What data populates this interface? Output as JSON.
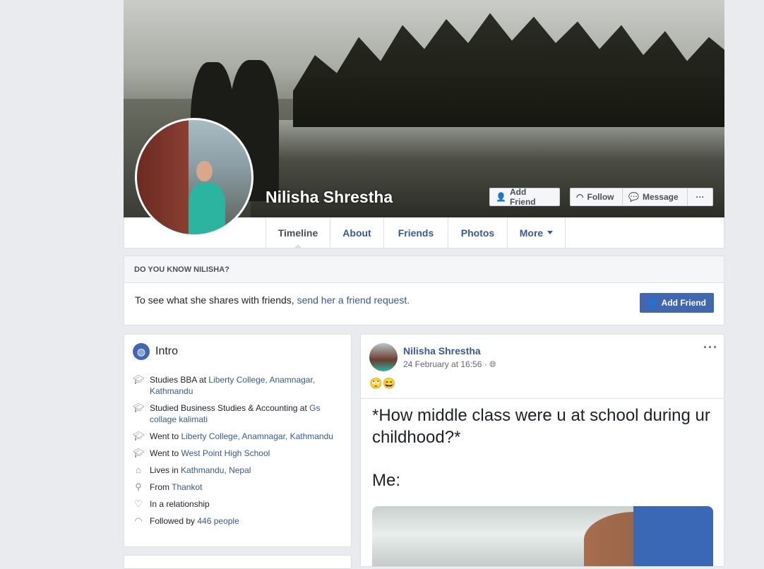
{
  "profile": {
    "name": "Nilisha Shrestha",
    "actions": {
      "add_friend": "Add Friend",
      "follow": "Follow",
      "message": "Message",
      "more": "···"
    }
  },
  "tabs": [
    {
      "label": "Timeline",
      "active": true
    },
    {
      "label": "About"
    },
    {
      "label": "Friends"
    },
    {
      "label": "Photos"
    },
    {
      "label": "More"
    }
  ],
  "know": {
    "heading": "DO YOU KNOW NILISHA?",
    "text": "To see what she shares with friends, ",
    "link": "send her a friend request.",
    "button": "Add Friend"
  },
  "intro": {
    "title": "Intro",
    "items": [
      {
        "icon": "graduation-cap-icon",
        "text": "Studies BBA at ",
        "link": "Liberty College, Anamnagar, Kathmandu"
      },
      {
        "icon": "graduation-cap-icon",
        "text": "Studied Business Studies & Accounting at ",
        "link": "Gs collage kalimati"
      },
      {
        "icon": "graduation-cap-icon",
        "text": "Went to ",
        "link": "Liberty College, Anamnagar, Kathmandu"
      },
      {
        "icon": "graduation-cap-icon",
        "text": "Went to ",
        "link": "West Point High School"
      },
      {
        "icon": "home-icon",
        "text": "Lives in ",
        "link": "Kathmandu, Nepal"
      },
      {
        "icon": "location-pin-icon",
        "text": "From ",
        "link": "Thankot"
      },
      {
        "icon": "heart-icon",
        "text": "In a relationship",
        "link": ""
      },
      {
        "icon": "rss-icon",
        "text": "Followed by ",
        "link": "446 people"
      }
    ]
  },
  "post": {
    "author": "Nilisha Shrestha",
    "time": "24 February at 16:56 ·",
    "emoji": "🙄😄",
    "image_text": "*How middle class were u at school during ur childhood?*",
    "image_text2": "Me:",
    "options": "···"
  },
  "colors": {
    "accent": "#4267b2",
    "link": "#385898",
    "background": "#e9ebee"
  }
}
